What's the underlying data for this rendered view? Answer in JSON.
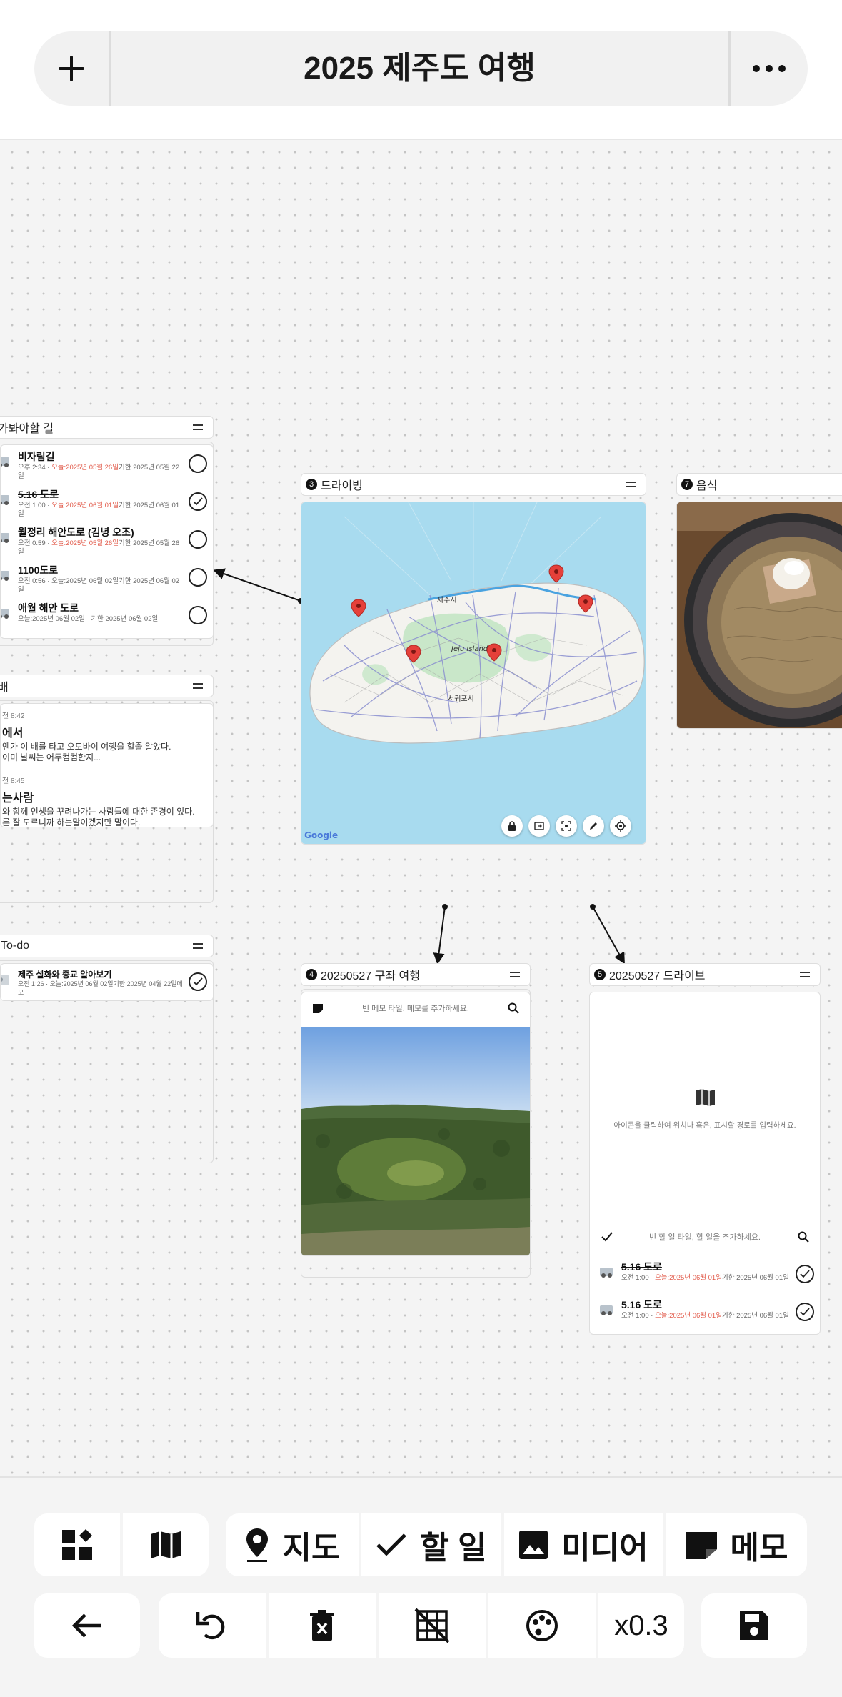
{
  "header": {
    "title": "2025 제주도 여행"
  },
  "cards": {
    "roads": {
      "title": "가봐야할 길",
      "items": [
        {
          "title": "비자림길",
          "done": false,
          "meta_pre": "오후 2:34 · ",
          "meta_red": "오늘:2025년 05월 26일",
          "meta_post": "기한 2025년 05월 22일"
        },
        {
          "title": "5.16 도로",
          "done": true,
          "meta_pre": "오전 1:00 · ",
          "meta_red": "오늘:2025년 06월 01일",
          "meta_post": "기한 2025년 06월 01일"
        },
        {
          "title": "월정리 해안도로 (김녕 오조)",
          "done": false,
          "meta_pre": "오전 0:59 · ",
          "meta_red": "오늘:2025년 05월 26일",
          "meta_post": "기한 2025년 05월 26일"
        },
        {
          "title": "1100도로",
          "done": false,
          "meta_pre": "오전 0:56 · ",
          "meta_red": "",
          "meta_post": "오늘:2025년 06월 02일기한 2025년 06월 02일"
        },
        {
          "title": "애월 해안 도로",
          "done": false,
          "meta_pre": "",
          "meta_red": "",
          "meta_post": "오늘:2025년 06월 02일 · 기한 2025년 06월 02일"
        }
      ]
    },
    "boat": {
      "title": "배",
      "memos": [
        {
          "time": "전 8:42",
          "title": "에서",
          "text": "엔가 이 배를 타고 오토바이 여행을 할줄 알았다.\n이미 날씨는 어두컴컴한지..."
        },
        {
          "time": "전 8:45",
          "title": "는사람",
          "text": "와 함께 인생을 꾸려나가는 사람들에 대한 존경이 있다.\n론 잘 모르니까 하는말이겠지만 말이다."
        }
      ]
    },
    "todo": {
      "title": "To-do",
      "items": [
        {
          "title": "제주 설화와 종교 알아보기",
          "done": true,
          "meta": "오전 1:26 · 오늘:2025년 06월 02일기한 2025년 04월 22일메모"
        }
      ]
    },
    "driving": {
      "num": "3",
      "title": "드라이빙",
      "map_labels": {
        "jeju": "제주시",
        "island": "Jeju Island",
        "seogwipo": "서귀포시",
        "google": "Google"
      }
    },
    "food": {
      "num": "7",
      "title": "음식"
    },
    "tour": {
      "num": "4",
      "title": "20250527 구좌 여행",
      "placeholder": "빈 메모 타일, 메모를 추가하세요."
    },
    "drive": {
      "num": "5",
      "title": "20250527 드라이브",
      "map_hint": "아이콘을 클릭하여 위치나 혹은, 표시할 경로를 입력하세요.",
      "todo_placeholder": "빈 할 일 타일, 할 일을 추가하세요.",
      "items": [
        {
          "title": "5.16 도로",
          "meta_pre": "오전 1:00 · ",
          "meta_red": "오늘:2025년 06월 01일",
          "meta_post": "기한 2025년 06월 01일"
        },
        {
          "title": "5.16 도로",
          "meta_pre": "오전 1:00 · ",
          "meta_red": "오늘:2025년 06월 01일",
          "meta_post": "기한 2025년 06월 01일"
        }
      ]
    }
  },
  "toolbar": {
    "map_label": "지도",
    "todo_label": "할 일",
    "media_label": "미디어",
    "memo_label": "메모",
    "zoom": "x0.3"
  },
  "colors": {
    "accent_red": "#e25b4b",
    "map_water": "#a8dbef",
    "map_pin": "#e5403a"
  }
}
